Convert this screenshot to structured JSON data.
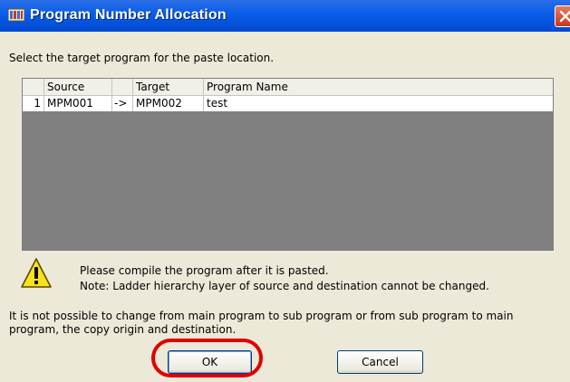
{
  "window": {
    "title": "Program Number Allocation"
  },
  "instruction": "Select the target program for the paste location.",
  "table": {
    "headers": [
      "",
      "Source",
      "",
      "Target",
      "Program Name"
    ],
    "rows": [
      {
        "index": "1",
        "source": "MPM001",
        "arrow": "->",
        "target": "MPM002",
        "name": "test"
      }
    ]
  },
  "warning": {
    "line1": "Please compile the program after it is pasted.",
    "line2": "Note: Ladder hierarchy layer of source and destination cannot be changed."
  },
  "info": {
    "line1": "It is not possible to change from main program to sub program or from sub program to main",
    "line2": "program, the copy origin and destination."
  },
  "buttons": {
    "ok": "OK",
    "cancel": "Cancel"
  },
  "colors": {
    "titlebar": "#0a5fe8",
    "highlight": "#e00000",
    "grid_background": "#808080"
  }
}
